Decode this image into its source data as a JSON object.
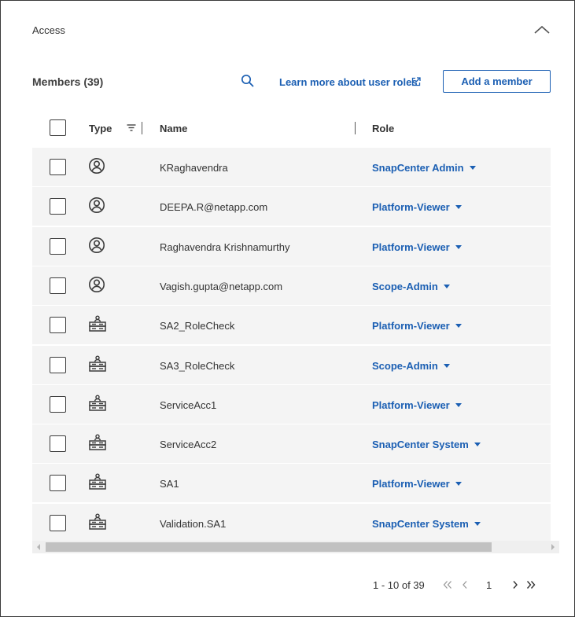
{
  "section": {
    "title": "Access"
  },
  "members": {
    "title": "Members (39)",
    "learn_more_label": "Learn more about user roles",
    "add_button_label": "Add a member"
  },
  "table": {
    "columns": {
      "type": "Type",
      "name": "Name",
      "role": "Role"
    },
    "rows": [
      {
        "type": "user",
        "name": "KRaghavendra",
        "role": "SnapCenter Admin"
      },
      {
        "type": "user",
        "name": "DEEPA.R@netapp.com",
        "role": "Platform-Viewer"
      },
      {
        "type": "user",
        "name": "Raghavendra Krishnamurthy",
        "role": "Platform-Viewer"
      },
      {
        "type": "user",
        "name": "Vagish.gupta@netapp.com",
        "role": "Scope-Admin"
      },
      {
        "type": "service-account",
        "name": "SA2_RoleCheck",
        "role": "Platform-Viewer"
      },
      {
        "type": "service-account",
        "name": "SA3_RoleCheck",
        "role": "Scope-Admin"
      },
      {
        "type": "service-account",
        "name": "ServiceAcc1",
        "role": "Platform-Viewer"
      },
      {
        "type": "service-account",
        "name": "ServiceAcc2",
        "role": "SnapCenter System"
      },
      {
        "type": "service-account",
        "name": "SA1",
        "role": "Platform-Viewer"
      },
      {
        "type": "service-account",
        "name": "Validation.SA1",
        "role": "SnapCenter System"
      }
    ]
  },
  "pagination": {
    "range": "1 - 10 of 39",
    "current_page": "1"
  },
  "icons": {
    "collapse": "chevron-up-icon",
    "search": "search-icon",
    "external_link": "external-link-icon",
    "filter": "filter-icon",
    "user": "user-circle-icon",
    "service_account": "service-account-icon",
    "first_page": "double-chevron-left-icon",
    "prev_page": "chevron-left-icon",
    "next_page": "chevron-right-icon",
    "last_page": "double-chevron-right-icon"
  },
  "colors": {
    "accent": "#1b5fb3",
    "row_background": "#f4f4f4",
    "text": "#333333"
  }
}
